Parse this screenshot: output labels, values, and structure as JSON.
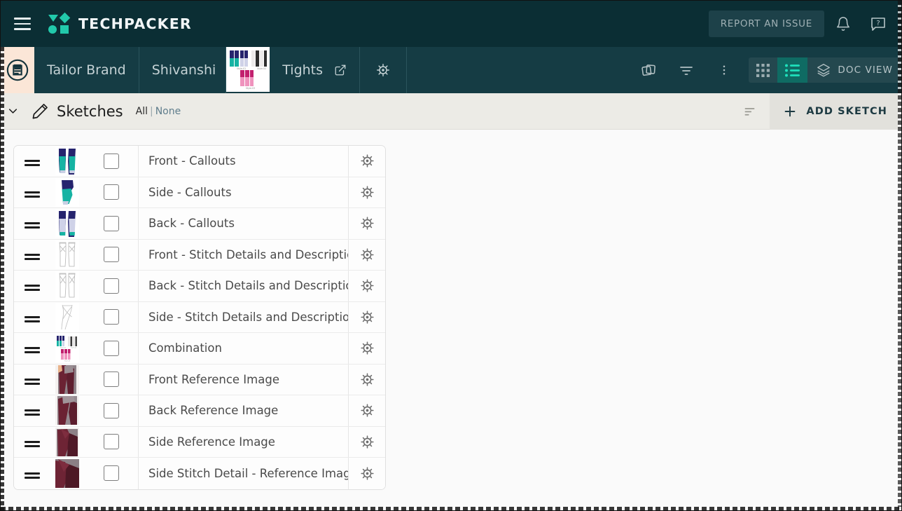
{
  "app": {
    "brand_name": "TECHPACKER",
    "accent_teal": "#22c9ab",
    "topbar_bg": "#0b2e34",
    "crumbbar_bg": "#153c44",
    "active_view_bg": "#0f6b63"
  },
  "topbar": {
    "menu_icon": "hamburger-menu-icon",
    "logo_icon": "techpacker-logo-icon",
    "report_issue_label": "REPORT AN ISSUE",
    "notification_icon": "bell-icon",
    "help_icon": "help-question-bubble-icon"
  },
  "breadcrumb": {
    "doc_icon": "clipboard-techpack-icon",
    "items": [
      {
        "label": "Tailor Brand",
        "name": "breadcrumb-brand"
      },
      {
        "label": "Shivanshi",
        "name": "breadcrumb-collection"
      },
      {
        "label": "Tights",
        "name": "breadcrumb-style"
      }
    ],
    "thumbnail_name": "breadcrumb-style-thumbnail",
    "external_link_icon": "external-link-icon",
    "settings_icon": "target-settings-icon"
  },
  "toolbar": {
    "duplicate_icon": "duplicate-copy-icon",
    "filter_icon": "filter-funnel-icon",
    "more_icon": "more-vertical-icon",
    "views": [
      {
        "name": "grid-view",
        "icon": "grid-view-icon",
        "active": false
      },
      {
        "name": "list-view",
        "icon": "list-view-icon",
        "active": true
      }
    ],
    "doc_view_label": "DOC VIEW",
    "doc_view_icon": "layers-icon"
  },
  "section": {
    "collapse_icon": "chevron-down-icon",
    "title_icon": "pencil-icon",
    "title": "Sketches",
    "select_all_label": "All",
    "select_separator": "|",
    "select_none_label": "None",
    "sort_icon": "sort-icon",
    "add_icon": "plus-icon",
    "add_label": "ADD SKETCH"
  },
  "sketches": {
    "rows": [
      {
        "label": "Front - Callouts",
        "thumb": "tights-front-navy-teal",
        "checked": false
      },
      {
        "label": "Side - Callouts",
        "thumb": "tights-side-navy-teal",
        "checked": false
      },
      {
        "label": "Back - Callouts",
        "thumb": "tights-back-navy-lavender",
        "checked": false
      },
      {
        "label": "Front - Stitch Details and Description",
        "thumb": "tights-front-line-sketch",
        "checked": false
      },
      {
        "label": "Back - Stitch Details and Description",
        "thumb": "tights-back-line-sketch",
        "checked": false
      },
      {
        "label": "Side - Stitch Details and Description",
        "thumb": "tights-side-line-sketch",
        "checked": false
      },
      {
        "label": "Combination",
        "thumb": "tights-colorway-collage",
        "checked": false
      },
      {
        "label": "Front Reference Image",
        "thumb": "photo-front-maroon",
        "checked": false
      },
      {
        "label": "Back Reference Image",
        "thumb": "photo-back-maroon",
        "checked": false
      },
      {
        "label": "Side Reference Image",
        "thumb": "photo-side-maroon",
        "checked": false
      },
      {
        "label": "Side Stitch Detail - Reference Image",
        "thumb": "photo-side-detail-maroon",
        "checked": false
      }
    ],
    "row_handle_icon": "drag-handle-icon",
    "row_gear_icon": "target-settings-icon",
    "row_checkbox_name": "row-checkbox"
  }
}
